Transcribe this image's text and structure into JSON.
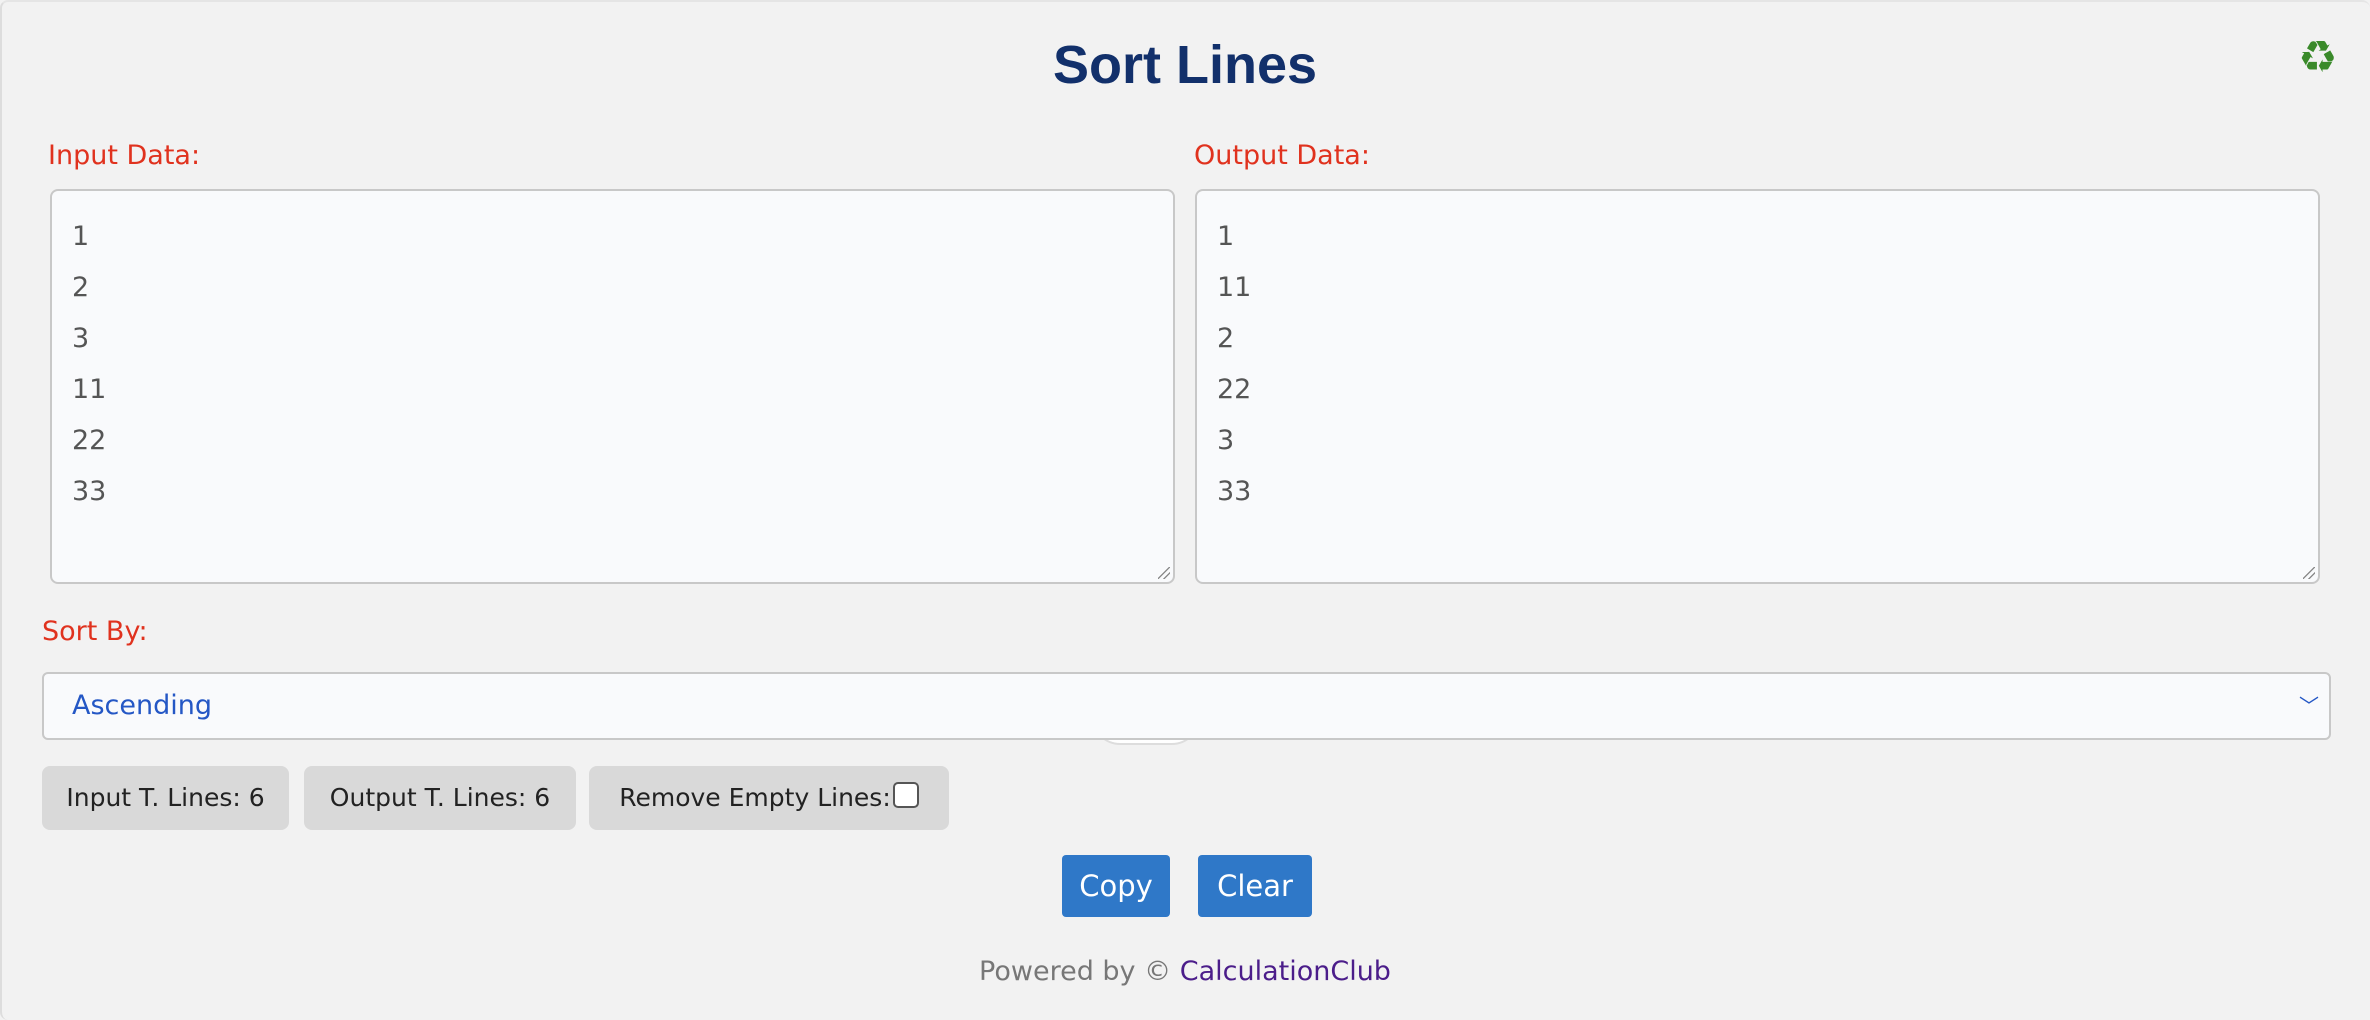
{
  "title": "Sort Lines",
  "header_icon": "recycle-icon",
  "input": {
    "label": "Input Data:",
    "lines": [
      "1",
      "2",
      "3",
      "11",
      "22",
      "33"
    ]
  },
  "output": {
    "label": "Output Data:",
    "lines": [
      "1",
      "11",
      "2",
      "22",
      "3",
      "33"
    ]
  },
  "sort": {
    "label": "Sort By:",
    "selected": "Ascending"
  },
  "stats": {
    "input_lines": "Input T. Lines: 6",
    "output_lines": "Output T. Lines: 6",
    "remove_empty": "Remove Empty Lines:",
    "remove_empty_checked": false
  },
  "buttons": {
    "copy": "Copy",
    "clear": "Clear"
  },
  "footer": {
    "prefix": "Powered by ©",
    "link": "CalculationClub"
  },
  "colors": {
    "title": "#12306b",
    "label": "#e0321e",
    "button": "#2f78c8",
    "select_text": "#2457c5",
    "footer_link": "#4b1d8a"
  }
}
